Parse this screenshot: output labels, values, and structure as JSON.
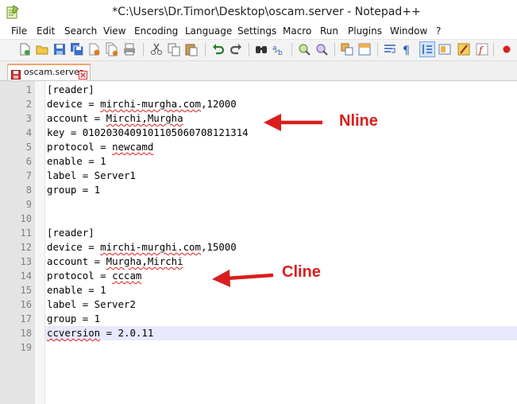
{
  "window": {
    "title": "*C:\\Users\\Dr.Timor\\Desktop\\oscam.server - Notepad++"
  },
  "menu": [
    "File",
    "Edit",
    "Search",
    "View",
    "Encoding",
    "Language",
    "Settings",
    "Macro",
    "Run",
    "Plugins",
    "Window",
    "?"
  ],
  "toolbar": {
    "icons": [
      "new-file-icon",
      "open-file-icon",
      "save-icon",
      "save-all-icon",
      "close-icon",
      "close-all-icon",
      "print-icon",
      "cut-icon",
      "copy-icon",
      "paste-icon",
      "undo-icon",
      "redo-icon",
      "find-icon",
      "replace-icon",
      "zoom-in-icon",
      "zoom-out-icon",
      "sync-vertical-icon",
      "sync-horizontal-icon",
      "word-wrap-icon",
      "show-all-chars-icon",
      "indent-guide-icon",
      "document-map-icon",
      "function-list-icon",
      "folder-workspace-icon",
      "record-macro-icon"
    ]
  },
  "tab": {
    "label": "oscam.server",
    "modified_color": "#d9343a"
  },
  "lines": [
    {
      "n": "1",
      "text": "[reader]"
    },
    {
      "n": "2",
      "pre": "device = ",
      "sq": "mirchi-murgha.com",
      "post": ",12000"
    },
    {
      "n": "3",
      "pre": "account = ",
      "sq": "Mirchi,Murgha",
      "post": ""
    },
    {
      "n": "4",
      "text": "key = 0102030409101105060708121314"
    },
    {
      "n": "5",
      "pre": "protocol = ",
      "sq": "newcamd",
      "post": ""
    },
    {
      "n": "6",
      "text": "enable = 1"
    },
    {
      "n": "7",
      "text": "label = Server1"
    },
    {
      "n": "8",
      "text": "group = 1"
    },
    {
      "n": "9",
      "text": ""
    },
    {
      "n": "10",
      "text": ""
    },
    {
      "n": "11",
      "text": "[reader]"
    },
    {
      "n": "12",
      "pre": "device = ",
      "sq": "mirchi-murghi.com",
      "post": ",15000"
    },
    {
      "n": "13",
      "pre": "account = ",
      "sq": "Murgha,Mirchi",
      "post": ""
    },
    {
      "n": "14",
      "pre": "protocol = ",
      "sq": "cccam",
      "post": ""
    },
    {
      "n": "15",
      "text": "enable = 1"
    },
    {
      "n": "16",
      "text": "label = Server2"
    },
    {
      "n": "17",
      "text": "group = 1"
    },
    {
      "n": "18",
      "pre": "",
      "sq": "ccversion",
      "post": " = 2.0.11"
    },
    {
      "n": "19",
      "text": ""
    }
  ],
  "annotations": {
    "nline": "Nline",
    "cline": "Cline",
    "color": "#d91e1e"
  }
}
